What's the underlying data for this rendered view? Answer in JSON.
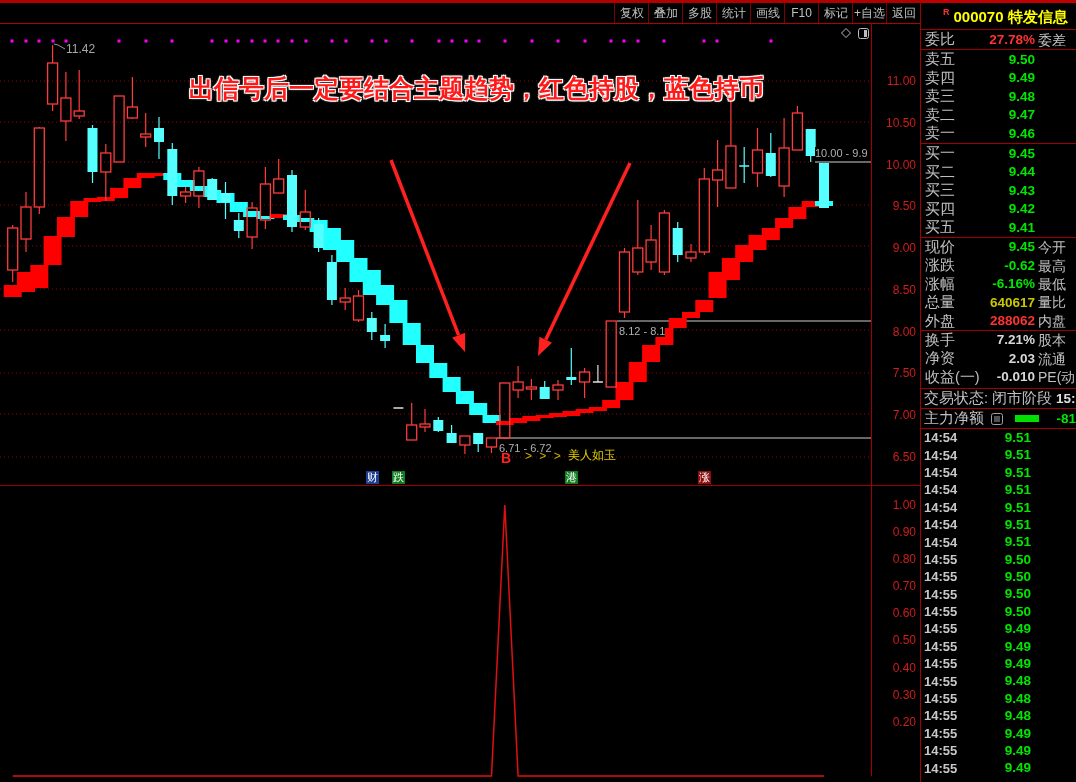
{
  "toolbar": {
    "buttons": [
      "复权",
      "叠加",
      "多股",
      "统计",
      "画线",
      "F10",
      "标记",
      "+自选",
      "返回"
    ]
  },
  "price_chart": {
    "headline": "出信号后一定要结合主题趋势，红色持股，蓝色持币",
    "high_label": "11.42",
    "range_labels": [
      "10.00 - 9.9",
      "8.12 - 8.1",
      "6.71 - 6.72"
    ],
    "signal": {
      "mark": "B",
      "chevrons": "> > >",
      "text": "美人如玉"
    },
    "event_tags": [
      {
        "label": "财",
        "color": "#1c3f94"
      },
      {
        "label": "跌",
        "color": "#0f7d1e"
      },
      {
        "label": "港",
        "color": "#0f7d1e"
      },
      {
        "label": "涨",
        "color": "#8c1010"
      }
    ],
    "axis_labels": [
      "11.00",
      "10.50",
      "10.00",
      "9.50",
      "9.00",
      "8.50",
      "8.00",
      "7.50",
      "7.00",
      "6.50"
    ]
  },
  "indicator": {
    "chart_data": {
      "type": "line",
      "categories": [
        null,
        null,
        null,
        null,
        null,
        null,
        null,
        null,
        null,
        null,
        null,
        null,
        null,
        null,
        null,
        null,
        null,
        null,
        null,
        null,
        null,
        null,
        null,
        null,
        null,
        null,
        null,
        null,
        null,
        null,
        null,
        null,
        null,
        null,
        null,
        null,
        null,
        null,
        null,
        null,
        null,
        null,
        null,
        null,
        null,
        null,
        null,
        null,
        null,
        null,
        null,
        null,
        null,
        null,
        null,
        null,
        null,
        null,
        null,
        null,
        null,
        null
      ],
      "ylim": [
        0,
        1.07
      ],
      "yticks": [
        {
          "value": 1,
          "label": "1.00"
        },
        {
          "value": 0.9,
          "label": "0.90"
        },
        {
          "value": 0.8,
          "label": "0.80"
        },
        {
          "value": 0.7,
          "label": "0.70"
        },
        {
          "value": 0.6,
          "label": "0.60"
        },
        {
          "value": 0.5,
          "label": "0.50"
        },
        {
          "value": 0.4,
          "label": "0.40"
        },
        {
          "value": 0.3,
          "label": "0.30"
        },
        {
          "value": 0.2,
          "label": "0.20"
        }
      ],
      "series": [
        {
          "color": "#e01010",
          "values": [
            0,
            0,
            0,
            0,
            0,
            0,
            0,
            0,
            0,
            0,
            0,
            0,
            0,
            0,
            0,
            0,
            0,
            0,
            0,
            0,
            0,
            0,
            0,
            0,
            0,
            0,
            0,
            0,
            0,
            0,
            0,
            0,
            0,
            0,
            0,
            0,
            0,
            1,
            0,
            0,
            0,
            0,
            0,
            0,
            0,
            0,
            0,
            0,
            0,
            0,
            0,
            0,
            0,
            0,
            0,
            0,
            0,
            0,
            0,
            0,
            0,
            0
          ]
        }
      ]
    }
  },
  "quote": {
    "market_flag": "R",
    "title": "000070 特发信息",
    "ratio": {
      "label": "委比",
      "value": "27.78%",
      "label_right": "委差"
    },
    "asks": [
      {
        "label": "卖五",
        "price": "9.50"
      },
      {
        "label": "卖四",
        "price": "9.49"
      },
      {
        "label": "卖三",
        "price": "9.48"
      },
      {
        "label": "卖二",
        "price": "9.47"
      },
      {
        "label": "卖一",
        "price": "9.46"
      }
    ],
    "bids": [
      {
        "label": "买一",
        "price": "9.45"
      },
      {
        "label": "买二",
        "price": "9.44"
      },
      {
        "label": "买三",
        "price": "9.43"
      },
      {
        "label": "买四",
        "price": "9.42"
      },
      {
        "label": "买五",
        "price": "9.41"
      }
    ],
    "stats": [
      {
        "label": "现价",
        "value": "9.45",
        "color": "#00e600",
        "label_right": "今开"
      },
      {
        "label": "涨跌",
        "value": "-0.62",
        "color": "#00e600",
        "label_right": "最高"
      },
      {
        "label": "涨幅",
        "value": "-6.16%",
        "color": "#00e600",
        "label_right": "最低"
      },
      {
        "label": "总量",
        "value": "640617",
        "color": "#c8c800",
        "label_right": "量比"
      },
      {
        "label": "外盘",
        "value": "288062",
        "color": "#ff3232",
        "label_right": "内盘"
      }
    ],
    "fundamentals": [
      {
        "label": "换手",
        "value": "7.21%",
        "label_right": "股本"
      },
      {
        "label": "净资",
        "value": "2.03",
        "label_right": "流通"
      },
      {
        "label": "收益(一)",
        "value": "-0.010",
        "label_right": "PE(动"
      }
    ],
    "trade_status": {
      "label": "交易状态:",
      "value": "闭市阶段",
      "time": "15:"
    },
    "main_net": {
      "label": "主力净额",
      "value": "-81"
    },
    "ticks": [
      {
        "time": "14:54",
        "price": "9.51"
      },
      {
        "time": "14:54",
        "price": "9.51"
      },
      {
        "time": "14:54",
        "price": "9.51"
      },
      {
        "time": "14:54",
        "price": "9.51"
      },
      {
        "time": "14:54",
        "price": "9.51"
      },
      {
        "time": "14:54",
        "price": "9.51"
      },
      {
        "time": "14:54",
        "price": "9.51"
      },
      {
        "time": "14:55",
        "price": "9.50"
      },
      {
        "time": "14:55",
        "price": "9.50"
      },
      {
        "time": "14:55",
        "price": "9.50"
      },
      {
        "time": "14:55",
        "price": "9.50"
      },
      {
        "time": "14:55",
        "price": "9.49"
      },
      {
        "time": "14:55",
        "price": "9.49"
      },
      {
        "time": "14:55",
        "price": "9.49"
      },
      {
        "time": "14:55",
        "price": "9.48"
      },
      {
        "time": "14:55",
        "price": "9.48"
      },
      {
        "time": "14:55",
        "price": "9.48"
      },
      {
        "time": "14:55",
        "price": "9.49"
      },
      {
        "time": "14:55",
        "price": "9.49"
      },
      {
        "time": "14:55",
        "price": "9.49"
      }
    ]
  }
}
